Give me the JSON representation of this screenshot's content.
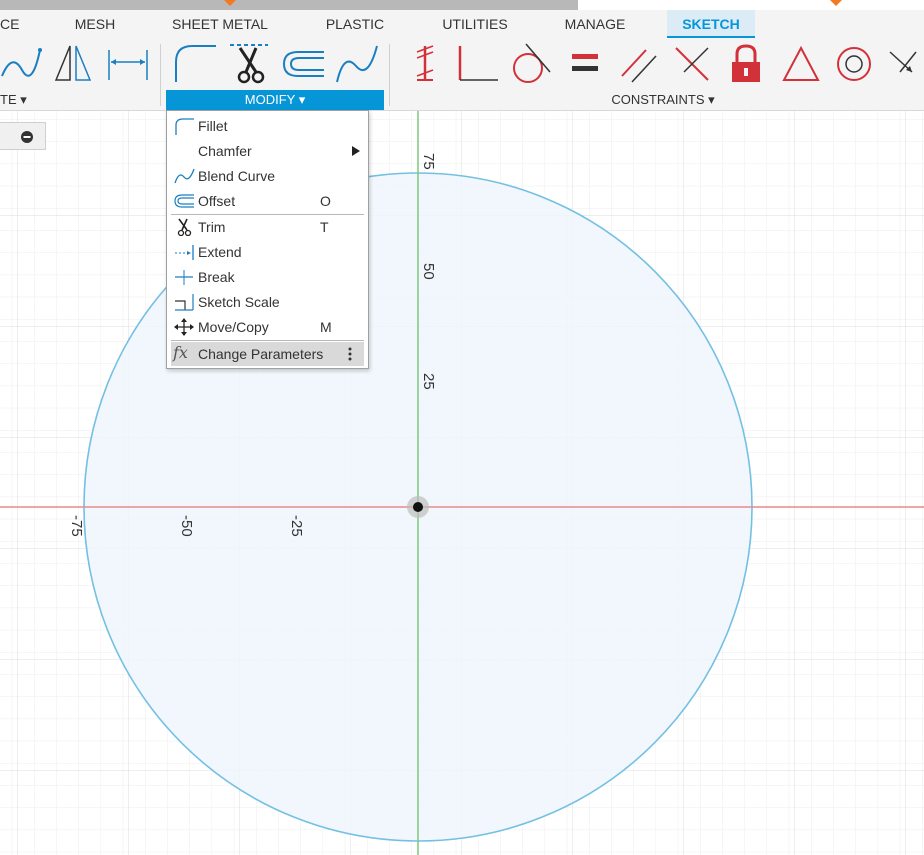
{
  "tabs": [
    {
      "label": "CE"
    },
    {
      "label": "MESH"
    },
    {
      "label": "SHEET METAL"
    },
    {
      "label": "PLASTIC"
    },
    {
      "label": "UTILITIES"
    },
    {
      "label": "MANAGE"
    },
    {
      "label": "SKETCH"
    }
  ],
  "groups": {
    "create_label": "TE ▾",
    "modify_label": "MODIFY ▾",
    "constraints_label": "CONSTRAINTS ▾"
  },
  "menu": {
    "items": [
      {
        "label": "Fillet",
        "shortcut": "",
        "icon": "fillet-icon"
      },
      {
        "label": "Chamfer",
        "shortcut": "",
        "icon": "chamfer-icon",
        "submenu": true
      },
      {
        "label": "Blend Curve",
        "shortcut": "",
        "icon": "blend-curve-icon"
      },
      {
        "label": "Offset",
        "shortcut": "O",
        "icon": "offset-icon"
      },
      {
        "label": "Trim",
        "shortcut": "T",
        "icon": "scissors-icon"
      },
      {
        "label": "Extend",
        "shortcut": "",
        "icon": "extend-icon"
      },
      {
        "label": "Break",
        "shortcut": "",
        "icon": "break-icon"
      },
      {
        "label": "Sketch Scale",
        "shortcut": "",
        "icon": "scale-icon"
      },
      {
        "label": "Move/Copy",
        "shortcut": "M",
        "icon": "move-icon"
      },
      {
        "label": "Change Parameters",
        "shortcut": "",
        "icon": "fx-icon"
      }
    ]
  },
  "axis_labels": {
    "y_75": "75",
    "y_50": "50",
    "y_25": "25",
    "x_neg75": "-75",
    "x_neg50": "-50",
    "x_neg25": "-25"
  },
  "colors": {
    "accent": "#0696d7",
    "constraint_red": "#d3313a",
    "circle_stroke": "#74c0e3",
    "circle_fill": "#eef6fc",
    "x_axis": "#e88a8a",
    "y_axis": "#7cc97c"
  }
}
